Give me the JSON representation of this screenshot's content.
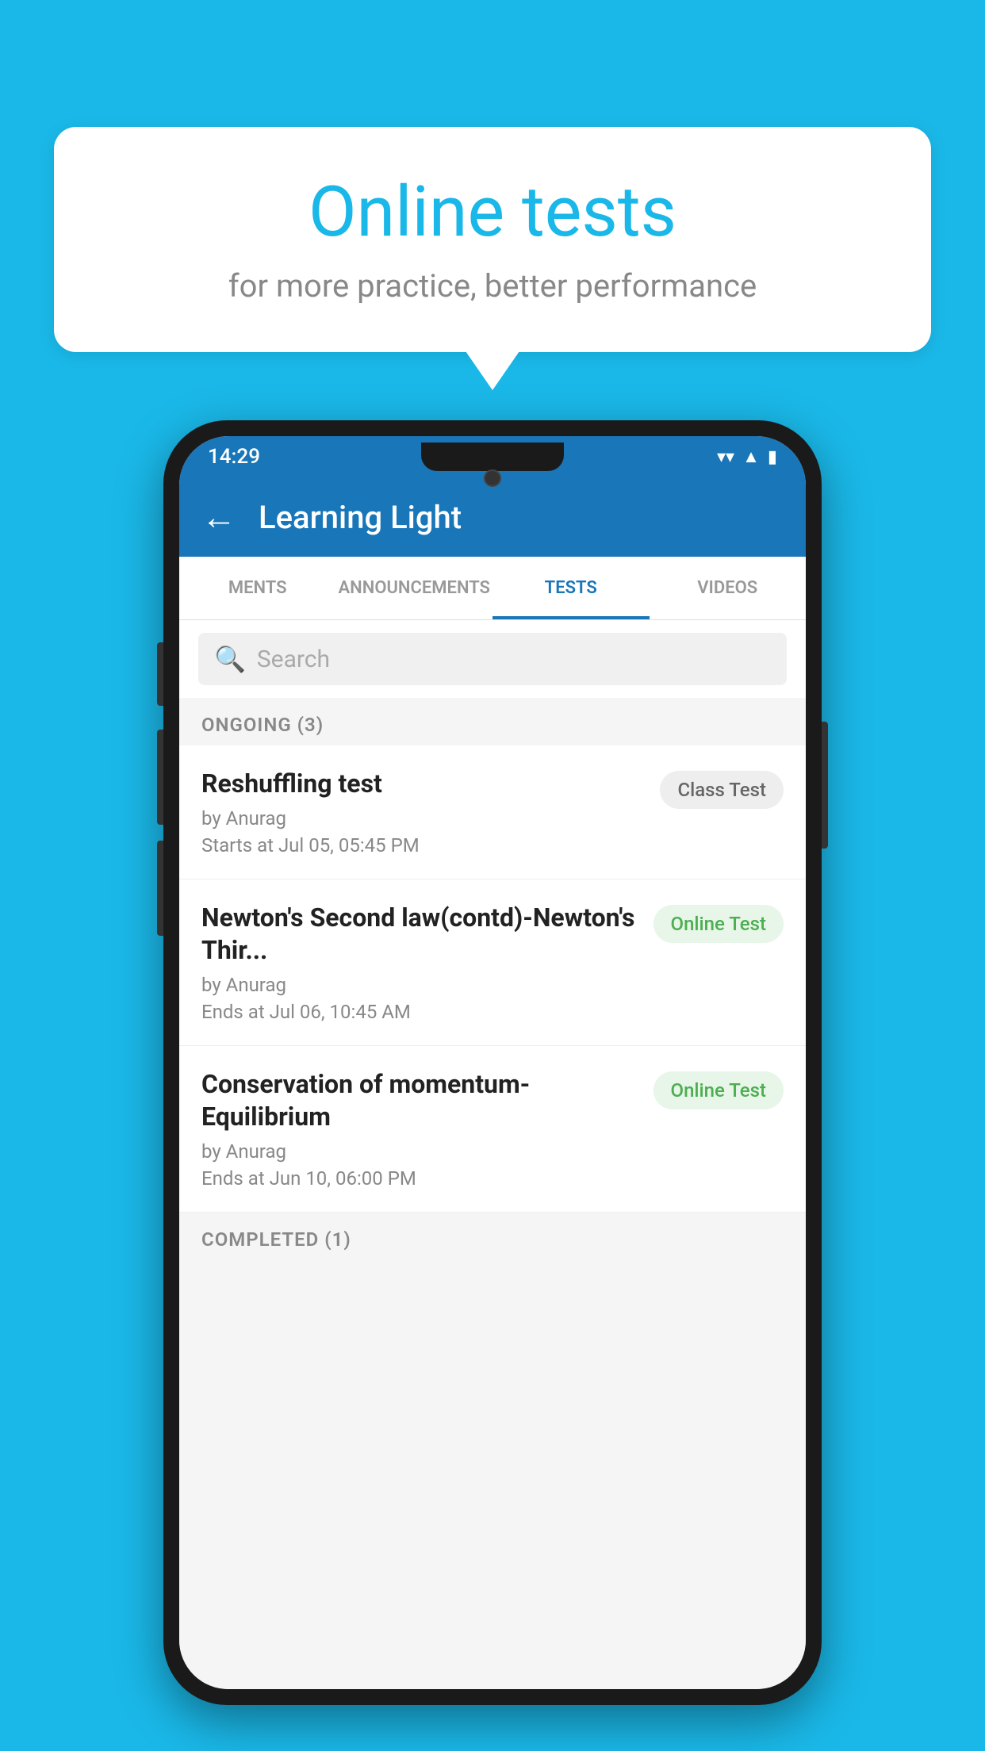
{
  "background": {
    "color": "#1ab8e8"
  },
  "bubble": {
    "title": "Online tests",
    "subtitle": "for more practice, better performance"
  },
  "phone": {
    "status_bar": {
      "time": "14:29",
      "wifi": "▼",
      "signal": "▲",
      "battery": "▮"
    },
    "app_bar": {
      "back_label": "←",
      "title": "Learning Light"
    },
    "tabs": [
      {
        "label": "MENTS",
        "active": false
      },
      {
        "label": "ANNOUNCEMENTS",
        "active": false
      },
      {
        "label": "TESTS",
        "active": true
      },
      {
        "label": "VIDEOS",
        "active": false
      }
    ],
    "search": {
      "placeholder": "Search"
    },
    "section_ongoing": {
      "label": "ONGOING (3)"
    },
    "test_items": [
      {
        "name": "Reshuffling test",
        "by": "by Anurag",
        "time_label": "Starts at",
        "time": "Jul 05, 05:45 PM",
        "badge": "Class Test",
        "badge_type": "class"
      },
      {
        "name": "Newton's Second law(contd)-Newton's Thir...",
        "by": "by Anurag",
        "time_label": "Ends at",
        "time": "Jul 06, 10:45 AM",
        "badge": "Online Test",
        "badge_type": "online"
      },
      {
        "name": "Conservation of momentum-Equilibrium",
        "by": "by Anurag",
        "time_label": "Ends at",
        "time": "Jun 10, 06:00 PM",
        "badge": "Online Test",
        "badge_type": "online"
      }
    ],
    "section_completed": {
      "label": "COMPLETED (1)"
    }
  }
}
